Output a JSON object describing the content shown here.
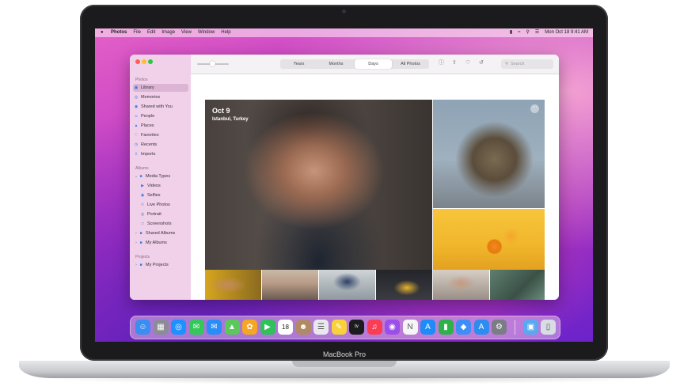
{
  "menubar": {
    "app_name": "Photos",
    "menus": [
      "File",
      "Edit",
      "Image",
      "View",
      "Window",
      "Help"
    ],
    "clock": "Mon Oct 18  9:41 AM"
  },
  "sidebar": {
    "section_photos": "Photos",
    "items": [
      {
        "label": "Library",
        "icon": "library-icon",
        "selected": true
      },
      {
        "label": "Memories",
        "icon": "memories-icon"
      },
      {
        "label": "Shared with You",
        "icon": "shared-with-you-icon"
      },
      {
        "label": "People",
        "icon": "people-icon"
      },
      {
        "label": "Places",
        "icon": "places-icon"
      },
      {
        "label": "Favorites",
        "icon": "heart-icon"
      },
      {
        "label": "Recents",
        "icon": "clock-icon"
      },
      {
        "label": "Imports",
        "icon": "imports-icon"
      }
    ],
    "section_albums": "Albums",
    "albums": [
      {
        "label": "Media Types",
        "icon": "folder-icon",
        "expanded": true
      },
      {
        "label": "Videos",
        "icon": "video-icon"
      },
      {
        "label": "Selfies",
        "icon": "selfie-icon"
      },
      {
        "label": "Live Photos",
        "icon": "live-photo-icon"
      },
      {
        "label": "Portrait",
        "icon": "portrait-icon"
      },
      {
        "label": "Screenshots",
        "icon": "screenshot-icon"
      },
      {
        "label": "Shared Albums",
        "icon": "shared-albums-icon"
      },
      {
        "label": "My Albums",
        "icon": "folder-icon"
      }
    ],
    "section_projects": "Projects",
    "projects": [
      {
        "label": "My Projects",
        "icon": "folder-icon"
      }
    ]
  },
  "toolbar": {
    "tabs": [
      "Years",
      "Months",
      "Days",
      "All Photos"
    ],
    "active_tab": "Days",
    "search_placeholder": "Search"
  },
  "main": {
    "hero_date": "Oct 9",
    "hero_location": "Istanbul, Turkey"
  },
  "dock": {
    "apps": [
      {
        "name": "finder-icon",
        "color": "#3b8df0"
      },
      {
        "name": "launchpad-icon",
        "color": "#8c8c96"
      },
      {
        "name": "safari-icon",
        "color": "#1e90ff"
      },
      {
        "name": "messages-icon",
        "color": "#34c759"
      },
      {
        "name": "mail-icon",
        "color": "#2a8cf7"
      },
      {
        "name": "maps-icon",
        "color": "#5ac85a"
      },
      {
        "name": "photos-icon",
        "color": "#f5a623"
      },
      {
        "name": "facetime-icon",
        "color": "#30c15a"
      },
      {
        "name": "calendar-icon",
        "color": "#f04a3d"
      },
      {
        "name": "contacts-icon",
        "color": "#b08a64"
      },
      {
        "name": "reminders-icon",
        "color": "#e8e8ee"
      },
      {
        "name": "notes-icon",
        "color": "#f7d23c"
      },
      {
        "name": "apple-tv-icon",
        "color": "#1c1c1e"
      },
      {
        "name": "music-icon",
        "color": "#fa3c55"
      },
      {
        "name": "podcasts-icon",
        "color": "#9b4ee8"
      },
      {
        "name": "news-icon",
        "color": "#f5f5f5"
      },
      {
        "name": "app-store-icon",
        "color": "#1d8cf8"
      },
      {
        "name": "numbers-icon",
        "color": "#2fb14a"
      },
      {
        "name": "keynote-icon",
        "color": "#3d8ef7"
      },
      {
        "name": "app-store-alt-icon",
        "color": "#2c8cf0"
      },
      {
        "name": "system-preferences-icon",
        "color": "#7b7d85"
      },
      {
        "name": "downloads-folder-icon",
        "color": "#5aa8f0"
      },
      {
        "name": "trash-icon",
        "color": "#d8dde3"
      }
    ],
    "calendar_day": "18"
  },
  "device": {
    "model_label": "MacBook Pro"
  }
}
